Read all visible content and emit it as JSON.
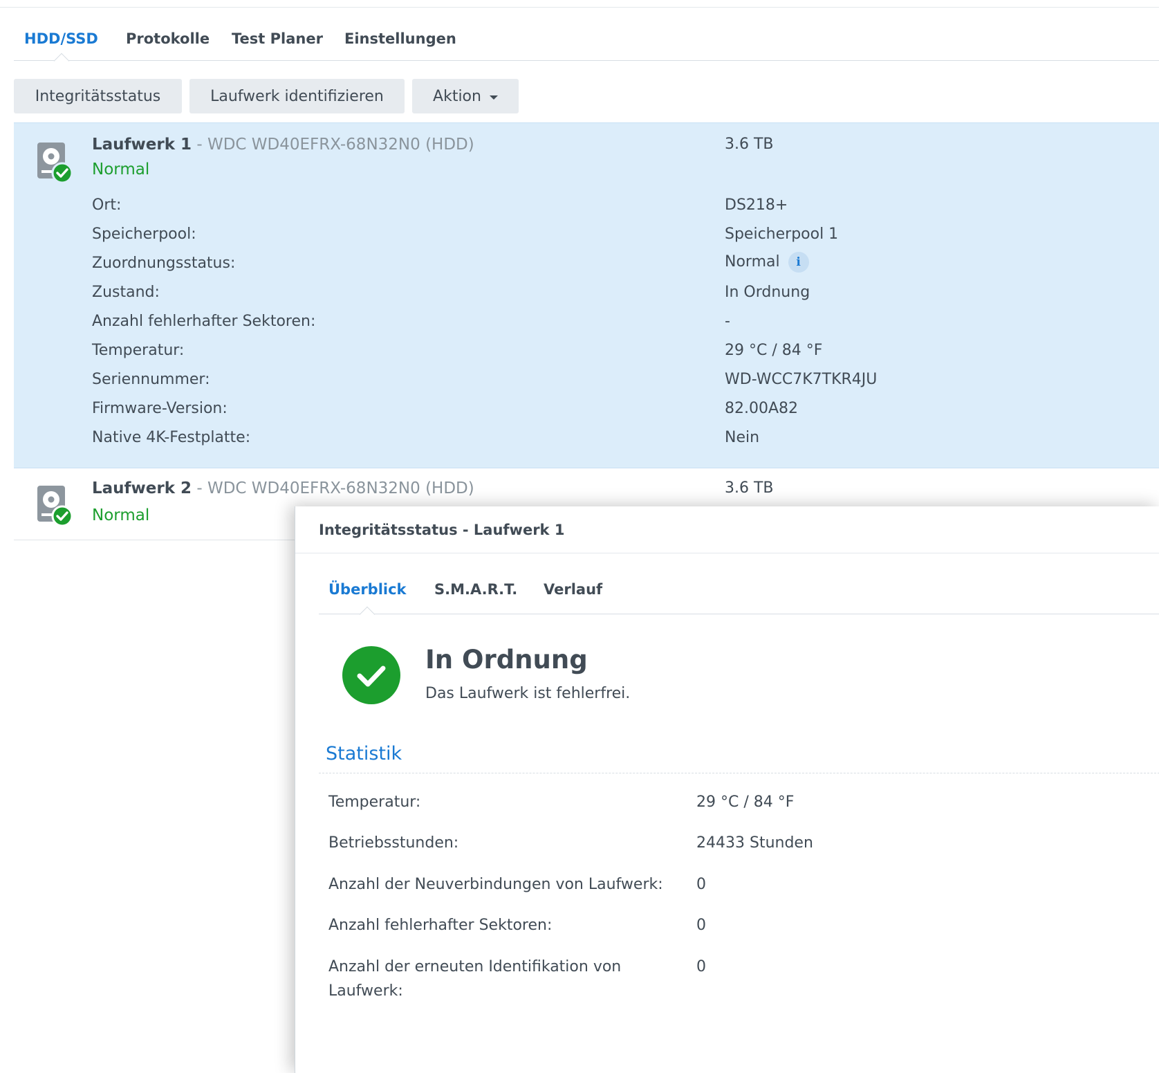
{
  "main_tabs": [
    {
      "label": "HDD/SSD",
      "active": true
    },
    {
      "label": "Protokolle",
      "active": false
    },
    {
      "label": "Test Planer",
      "active": false
    },
    {
      "label": "Einstellungen",
      "active": false
    }
  ],
  "toolbar": {
    "health_label": "Integritätsstatus",
    "identify_label": "Laufwerk identifizieren",
    "action_label": "Aktion"
  },
  "drives": [
    {
      "name": "Laufwerk 1",
      "model": " - WDC WD40EFRX-68N32N0 (HDD)",
      "status": "Normal",
      "capacity": "3.6 TB",
      "details": [
        {
          "label": "Ort:",
          "value": "DS218+"
        },
        {
          "label": "Speicherpool:",
          "value": "Speicherpool 1"
        },
        {
          "label": "Zuordnungsstatus:",
          "value": "Normal"
        },
        {
          "label": "Zustand:",
          "value": "In Ordnung"
        },
        {
          "label": "Anzahl fehlerhafter Sektoren:",
          "value": "-"
        },
        {
          "label": "Temperatur:",
          "value": "29 °C / 84 °F"
        },
        {
          "label": "Seriennummer:",
          "value": "WD-WCC7K7TKR4JU"
        },
        {
          "label": "Firmware-Version:",
          "value": "82.00A82"
        },
        {
          "label": "Native 4K-Festplatte:",
          "value": "Nein"
        }
      ]
    },
    {
      "name": "Laufwerk 2",
      "model": " - WDC WD40EFRX-68N32N0 (HDD)",
      "status": "Normal",
      "capacity": "3.6 TB"
    }
  ],
  "info_icon_glyph": "i",
  "dialog": {
    "title": "Integritätsstatus - Laufwerk 1",
    "tabs": [
      {
        "label": "Überblick",
        "active": true
      },
      {
        "label": "S.M.A.R.T.",
        "active": false
      },
      {
        "label": "Verlauf",
        "active": false
      }
    ],
    "health_title": "In Ordnung",
    "health_description": "Das Laufwerk ist fehlerfrei.",
    "section_title": "Statistik",
    "stats": [
      {
        "label": "Temperatur:",
        "value": "29 °C / 84 °F"
      },
      {
        "label": "Betriebsstunden:",
        "value": "24433 Stunden"
      },
      {
        "label": "Anzahl der Neuverbindungen von Laufwerk:",
        "value": "0"
      },
      {
        "label": "Anzahl fehlerhafter Sektoren:",
        "value": "0"
      },
      {
        "label": "Anzahl der erneuten Identifikation von Laufwerk:",
        "value": "0"
      }
    ]
  },
  "colors": {
    "accent": "#1a7ad3",
    "ok_green": "#1c9e2e",
    "selected_row": "#dcedfa",
    "icon_gray": "#8d969e"
  }
}
